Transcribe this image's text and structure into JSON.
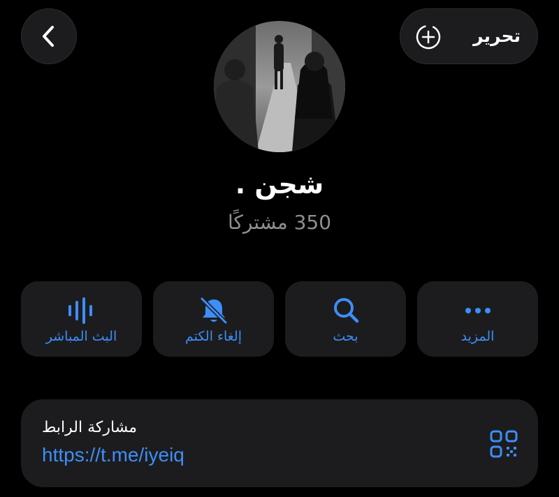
{
  "header": {
    "back_icon": "chevron-left-icon",
    "edit_label": "تحرير",
    "edit_icon": "circle-plus-icon"
  },
  "profile": {
    "name": "شجن .",
    "subscribers": "350 مشتركًا"
  },
  "actions": [
    {
      "label": "المزيد",
      "icon": "more-dots-icon"
    },
    {
      "label": "بحث",
      "icon": "search-icon"
    },
    {
      "label": "إلغاء الكتم",
      "icon": "bell-slash-icon"
    },
    {
      "label": "البث المباشر",
      "icon": "live-stream-icon"
    }
  ],
  "share": {
    "title": "مشاركة الرابط",
    "url": "https://t.me/iyeiq",
    "icon": "qr-code-icon"
  },
  "colors": {
    "accent": "#3e8ef7",
    "background": "#000000",
    "surface": "#1c1c1e",
    "secondary_text": "#8e8e93"
  }
}
